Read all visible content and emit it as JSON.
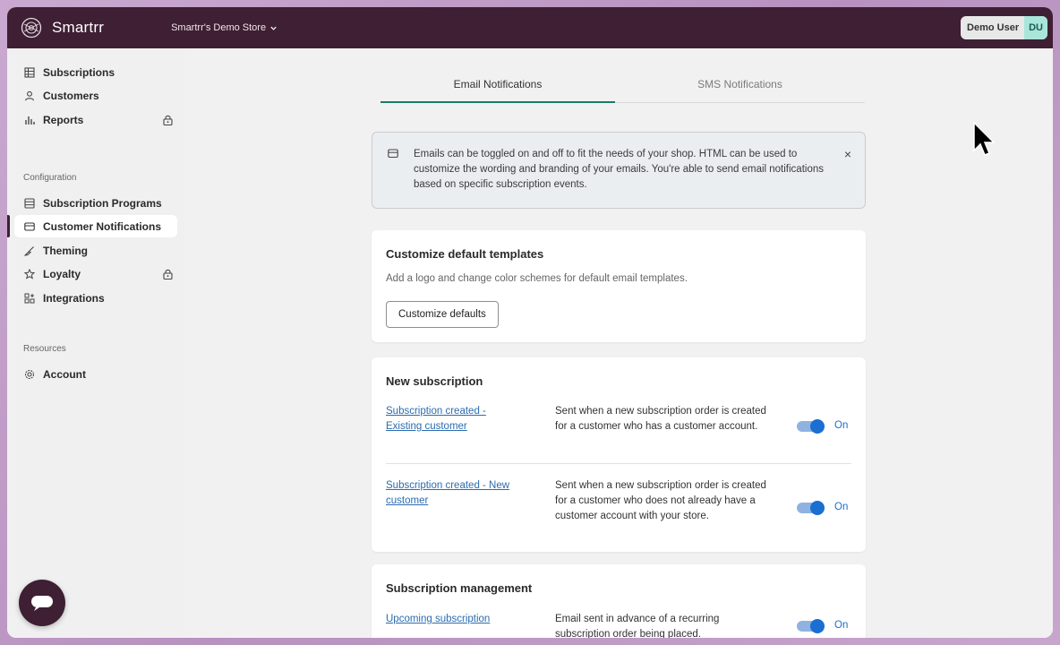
{
  "topbar": {
    "app_name": "Smartrr",
    "store_name": "Smartrr's Demo Store",
    "user_name": "Demo User",
    "user_initials": "DU"
  },
  "sidebar": {
    "items": [
      {
        "label": "Subscriptions",
        "icon": "table-icon"
      },
      {
        "label": "Customers",
        "icon": "user-icon"
      },
      {
        "label": "Reports",
        "icon": "bar-chart-icon",
        "locked": true
      }
    ],
    "config_label": "Configuration",
    "config_items": [
      {
        "label": "Subscription Programs",
        "icon": "list-icon"
      },
      {
        "label": "Customer Notifications",
        "icon": "envelope-icon",
        "active": true
      },
      {
        "label": "Theming",
        "icon": "brush-icon"
      },
      {
        "label": "Loyalty",
        "icon": "star-icon",
        "locked": true
      },
      {
        "label": "Integrations",
        "icon": "apps-icon"
      }
    ],
    "resources_label": "Resources",
    "resource_items": [
      {
        "label": "Account",
        "icon": "gear-icon"
      }
    ]
  },
  "tabs": {
    "email": "Email Notifications",
    "sms": "SMS Notifications"
  },
  "banner": {
    "text": "Emails can be toggled on and off to fit the needs of your shop. HTML can be used to customize the wording and branding of your emails. You're able to send email notifications based on specific subscription events.",
    "close": "×"
  },
  "templates_card": {
    "title": "Customize default templates",
    "subtitle": "Add a logo and change color schemes for default email templates.",
    "button": "Customize defaults"
  },
  "new_subscription": {
    "title": "New subscription",
    "rows": [
      {
        "link": "Subscription created - Existing customer",
        "desc": "Sent when a new subscription order is created for a customer who has a customer account.",
        "state": "On"
      },
      {
        "link": "Subscription created - New customer",
        "desc": "Sent when a new subscription order is created for a customer who does not already have a customer account with your store.",
        "state": "On"
      }
    ]
  },
  "subscription_management": {
    "title": "Subscription management",
    "rows": [
      {
        "link": "Upcoming subscription",
        "desc": "Email sent in advance of a recurring subscription order being placed.",
        "state": "On"
      }
    ]
  },
  "colors": {
    "brand": "#3e1f33",
    "accent": "#1b7a68",
    "toggle": "#1a6fd1",
    "link": "#2b6cb0"
  }
}
